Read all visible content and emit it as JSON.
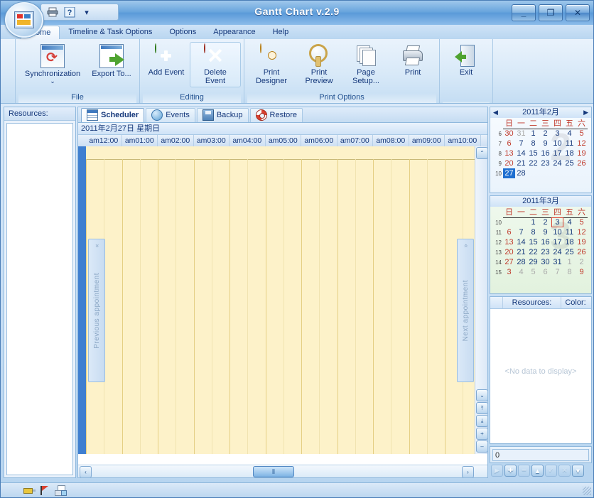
{
  "window": {
    "title": "Gantt Chart v.2.9",
    "minimize": "_",
    "maximize": "❐",
    "close": "✕"
  },
  "quick_access": {
    "print": "print-icon",
    "help": "help-icon",
    "more": "▾"
  },
  "ribbon": {
    "tabs": [
      {
        "label": "Home",
        "active": true
      },
      {
        "label": "Timeline & Task Options",
        "active": false
      },
      {
        "label": "Options",
        "active": false
      },
      {
        "label": "Appearance",
        "active": false
      },
      {
        "label": "Help",
        "active": false
      }
    ],
    "groups": [
      {
        "name": "File",
        "label": "File",
        "buttons": [
          {
            "label": "Synchronization",
            "dropdown": "⌄",
            "icon": "synchronization-icon"
          },
          {
            "label": "Export To...",
            "dropdown": "⌄",
            "icon": "export-icon"
          }
        ]
      },
      {
        "name": "Editing",
        "label": "Editing",
        "buttons": [
          {
            "label": "Add Event",
            "dropdown": "",
            "icon": "add-event-icon"
          },
          {
            "label": "Delete Event",
            "dropdown": "⌄",
            "icon": "delete-event-icon"
          }
        ]
      },
      {
        "name": "Print Options",
        "label": "Print Options",
        "buttons": [
          {
            "label": "Print Designer",
            "dropdown": "",
            "icon": "print-designer-icon"
          },
          {
            "label": "Print Preview",
            "dropdown": "",
            "icon": "print-preview-icon"
          },
          {
            "label": "Page Setup...",
            "dropdown": "",
            "icon": "page-setup-icon"
          },
          {
            "label": "Print",
            "dropdown": "",
            "icon": "print-icon"
          }
        ]
      },
      {
        "name": "Exit",
        "label": "",
        "buttons": [
          {
            "label": "Exit",
            "dropdown": "",
            "icon": "exit-icon"
          }
        ]
      }
    ]
  },
  "left_panel": {
    "header": "Resources:"
  },
  "view_tabs": [
    {
      "label": "Scheduler",
      "icon": "scheduler-icon",
      "active": true
    },
    {
      "label": "Events",
      "icon": "events-icon",
      "active": false
    },
    {
      "label": "Backup",
      "icon": "backup-icon",
      "active": false
    },
    {
      "label": "Restore",
      "icon": "restore-icon",
      "active": false
    }
  ],
  "scheduler": {
    "date_header": "2011年2月27日 星期日",
    "hours": [
      "am12:00",
      "am01:00",
      "am02:00",
      "am03:00",
      "am04:00",
      "am05:00",
      "am06:00",
      "am07:00",
      "am08:00",
      "am09:00",
      "am10:00"
    ],
    "previous_appointment": "Previous appointment",
    "previous_chevron": "«",
    "next_appointment": "Next appointment",
    "next_chevron": "»",
    "scroll_up": "⌃",
    "scroll_down": "⌄",
    "zoom_in_time": "⤒",
    "zoom_out_time": "⤓",
    "plus": "+",
    "minus": "–",
    "hscroll_left": "‹",
    "hscroll_right": "›",
    "hscroll_thumb": "⦀"
  },
  "calendars": [
    {
      "title": "2011年2月",
      "watermark": "2",
      "prev": "◀",
      "next": "▶",
      "dow": [
        "日",
        "一",
        "二",
        "三",
        "四",
        "五",
        "六"
      ],
      "weeks": [
        {
          "wk": "6",
          "days": [
            {
              "d": "30",
              "cls": "sun"
            },
            {
              "d": "31",
              "cls": "dim"
            },
            {
              "d": "1",
              "cls": ""
            },
            {
              "d": "2",
              "cls": ""
            },
            {
              "d": "3",
              "cls": ""
            },
            {
              "d": "4",
              "cls": ""
            },
            {
              "d": "5",
              "cls": "sat"
            }
          ]
        },
        {
          "wk": "7",
          "days": [
            {
              "d": "6",
              "cls": "sun"
            },
            {
              "d": "7",
              "cls": ""
            },
            {
              "d": "8",
              "cls": ""
            },
            {
              "d": "9",
              "cls": ""
            },
            {
              "d": "10",
              "cls": ""
            },
            {
              "d": "11",
              "cls": ""
            },
            {
              "d": "12",
              "cls": "sat"
            }
          ]
        },
        {
          "wk": "8",
          "days": [
            {
              "d": "13",
              "cls": "sun"
            },
            {
              "d": "14",
              "cls": ""
            },
            {
              "d": "15",
              "cls": ""
            },
            {
              "d": "16",
              "cls": ""
            },
            {
              "d": "17",
              "cls": ""
            },
            {
              "d": "18",
              "cls": ""
            },
            {
              "d": "19",
              "cls": "sat"
            }
          ]
        },
        {
          "wk": "9",
          "days": [
            {
              "d": "20",
              "cls": "sun"
            },
            {
              "d": "21",
              "cls": ""
            },
            {
              "d": "22",
              "cls": ""
            },
            {
              "d": "23",
              "cls": ""
            },
            {
              "d": "24",
              "cls": ""
            },
            {
              "d": "25",
              "cls": ""
            },
            {
              "d": "26",
              "cls": "sat"
            }
          ]
        },
        {
          "wk": "10",
          "days": [
            {
              "d": "27",
              "cls": "sel"
            },
            {
              "d": "28",
              "cls": ""
            },
            {
              "d": "",
              "cls": ""
            },
            {
              "d": "",
              "cls": ""
            },
            {
              "d": "",
              "cls": ""
            },
            {
              "d": "",
              "cls": ""
            },
            {
              "d": "",
              "cls": ""
            }
          ]
        }
      ]
    },
    {
      "title": "2011年3月",
      "watermark": "3",
      "prev": "",
      "next": "",
      "dow": [
        "日",
        "一",
        "二",
        "三",
        "四",
        "五",
        "六"
      ],
      "weeks": [
        {
          "wk": "10",
          "days": [
            {
              "d": "",
              "cls": ""
            },
            {
              "d": "",
              "cls": ""
            },
            {
              "d": "1",
              "cls": ""
            },
            {
              "d": "2",
              "cls": ""
            },
            {
              "d": "3",
              "cls": "today"
            },
            {
              "d": "4",
              "cls": ""
            },
            {
              "d": "5",
              "cls": "sat"
            }
          ]
        },
        {
          "wk": "11",
          "days": [
            {
              "d": "6",
              "cls": "sun"
            },
            {
              "d": "7",
              "cls": ""
            },
            {
              "d": "8",
              "cls": ""
            },
            {
              "d": "9",
              "cls": ""
            },
            {
              "d": "10",
              "cls": ""
            },
            {
              "d": "11",
              "cls": ""
            },
            {
              "d": "12",
              "cls": "sat"
            }
          ]
        },
        {
          "wk": "12",
          "days": [
            {
              "d": "13",
              "cls": "sun"
            },
            {
              "d": "14",
              "cls": ""
            },
            {
              "d": "15",
              "cls": ""
            },
            {
              "d": "16",
              "cls": ""
            },
            {
              "d": "17",
              "cls": ""
            },
            {
              "d": "18",
              "cls": ""
            },
            {
              "d": "19",
              "cls": "sat"
            }
          ]
        },
        {
          "wk": "13",
          "days": [
            {
              "d": "20",
              "cls": "sun"
            },
            {
              "d": "21",
              "cls": ""
            },
            {
              "d": "22",
              "cls": ""
            },
            {
              "d": "23",
              "cls": ""
            },
            {
              "d": "24",
              "cls": ""
            },
            {
              "d": "25",
              "cls": ""
            },
            {
              "d": "26",
              "cls": "sat"
            }
          ]
        },
        {
          "wk": "14",
          "days": [
            {
              "d": "27",
              "cls": "sun"
            },
            {
              "d": "28",
              "cls": ""
            },
            {
              "d": "29",
              "cls": ""
            },
            {
              "d": "30",
              "cls": ""
            },
            {
              "d": "31",
              "cls": ""
            },
            {
              "d": "1",
              "cls": "dim"
            },
            {
              "d": "2",
              "cls": "dim sat"
            }
          ]
        },
        {
          "wk": "15",
          "days": [
            {
              "d": "3",
              "cls": "sun"
            },
            {
              "d": "4",
              "cls": "dim"
            },
            {
              "d": "5",
              "cls": "dim"
            },
            {
              "d": "6",
              "cls": "dim"
            },
            {
              "d": "7",
              "cls": "dim"
            },
            {
              "d": "8",
              "cls": "dim"
            },
            {
              "d": "9",
              "cls": "sat"
            }
          ]
        }
      ]
    }
  ],
  "resources_grid": {
    "columns": [
      "Resources:",
      "Color:"
    ],
    "empty_text": "<No data to display>"
  },
  "value_box": {
    "value": "0"
  },
  "record_nav": [
    {
      "name": "move-next-button",
      "glyph": "▶",
      "disabled": true
    },
    {
      "name": "add-record-button",
      "glyph": "✚",
      "disabled": false
    },
    {
      "name": "delete-record-button",
      "glyph": "━",
      "disabled": true
    },
    {
      "name": "edit-record-button",
      "glyph": "▲",
      "disabled": false
    },
    {
      "name": "accept-button",
      "glyph": "✓",
      "disabled": true
    },
    {
      "name": "cancel-button",
      "glyph": "✕",
      "disabled": true
    },
    {
      "name": "filter-button",
      "glyph": "▼",
      "disabled": false
    }
  ],
  "status_bar": {
    "icons": [
      "progress-icon",
      "flag-icon",
      "grid-icon"
    ]
  },
  "colors": {
    "titlebar": "#5b9ad9",
    "accent": "#1f6fd0",
    "scheduler_background": "#fdf2c9",
    "selected_day": "#1f6fd0",
    "today_outline": "#d9402f",
    "march_calendar": "#e2f2de"
  }
}
